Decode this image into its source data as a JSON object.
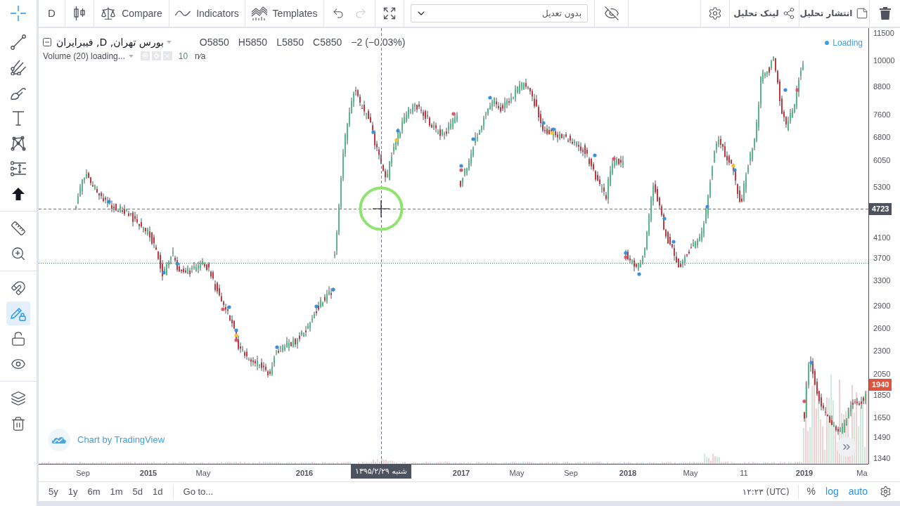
{
  "left_toolbar": {
    "groups": [
      {
        "items": [
          {
            "kind": "crosshair",
            "selected": true
          },
          {
            "kind": "trend_line",
            "selected": false
          },
          {
            "kind": "pitchfork",
            "selected": false
          },
          {
            "kind": "brush",
            "selected": false
          },
          {
            "kind": "text",
            "selected": false
          },
          {
            "kind": "pattern",
            "selected": false
          },
          {
            "kind": "projection",
            "selected": false
          },
          {
            "kind": "arrow",
            "selected": false
          }
        ]
      },
      {
        "items": [
          {
            "kind": "ruler",
            "selected": false
          },
          {
            "kind": "zoom",
            "selected": false
          }
        ]
      },
      {
        "items": [
          {
            "kind": "magnet",
            "on": false
          },
          {
            "kind": "stay_in_drawing",
            "on": true
          },
          {
            "kind": "lock",
            "on": false
          },
          {
            "kind": "visibility",
            "on": false
          }
        ]
      },
      {
        "items": [
          {
            "kind": "layers"
          },
          {
            "kind": "remove"
          }
        ]
      }
    ]
  },
  "toolbar": {
    "interval": "D",
    "compare": "Compare",
    "indicators": "Indicators",
    "templates": "Templates",
    "undo": {
      "disabled": false
    },
    "redo": {
      "disabled": true
    },
    "adjustment": {
      "value": "بدون تعدیل"
    },
    "link_analysis": "لینک تحلیل",
    "publish_analysis": "انتشار تحلیل"
  },
  "legend": {
    "symbol": "بورس تهران, D, فیبرایران",
    "ohlc": [
      "O5850",
      "H5850",
      "L5850",
      "C5850"
    ],
    "change": "−2 (−0.03%)",
    "study": {
      "title": "Volume (20) loading...",
      "value": "10",
      "status": "n∕a"
    }
  },
  "status": {
    "label": "Loading"
  },
  "attribution": "Chart by TradingView",
  "price_axis": {
    "labels": [
      {
        "text": "11500",
        "kind": "tick"
      },
      {
        "text": "10000",
        "kind": "tick"
      },
      {
        "text": "8800",
        "kind": "tick"
      },
      {
        "text": "7600",
        "kind": "tick"
      },
      {
        "text": "6800",
        "kind": "tick"
      },
      {
        "text": "6050",
        "kind": "tick"
      },
      {
        "text": "5300",
        "kind": "tick"
      },
      {
        "text": "4723",
        "kind": "crosshair"
      },
      {
        "text": "4100",
        "kind": "tick"
      },
      {
        "text": "3700",
        "kind": "tick"
      },
      {
        "text": "3300",
        "kind": "tick"
      },
      {
        "text": "2900",
        "kind": "tick"
      },
      {
        "text": "2600",
        "kind": "tick"
      },
      {
        "text": "2300",
        "kind": "tick"
      },
      {
        "text": "2050",
        "kind": "tick"
      },
      {
        "text": "1940",
        "kind": "last_price"
      },
      {
        "text": "1850",
        "kind": "tick"
      },
      {
        "text": "1650",
        "kind": "tick"
      },
      {
        "text": "1490",
        "kind": "tick"
      },
      {
        "text": "1340",
        "kind": "tick"
      }
    ]
  },
  "time_axis": {
    "labels": [
      {
        "text": "Sep",
        "kind": "month"
      },
      {
        "text": "2015",
        "kind": "year"
      },
      {
        "text": "May",
        "kind": "month"
      },
      {
        "text": "2016",
        "kind": "year"
      },
      {
        "text": "شنبه ۱۳۹۵/۲/۲۹",
        "kind": "crosshair"
      },
      {
        "text": "2017",
        "kind": "year"
      },
      {
        "text": "May",
        "kind": "month"
      },
      {
        "text": "Sep",
        "kind": "month"
      },
      {
        "text": "2018",
        "kind": "year"
      },
      {
        "text": "May",
        "kind": "month"
      },
      {
        "text": "11",
        "kind": "month"
      },
      {
        "text": "2019",
        "kind": "year"
      },
      {
        "text": "Ma",
        "kind": "month"
      }
    ]
  },
  "bottom_bar": {
    "ranges": [
      "5y",
      "1y",
      "6m",
      "1m",
      "5d",
      "1d"
    ],
    "goto": "Go to...",
    "time": "۱۲:۲۳ (UTC)",
    "scale_modes": [
      {
        "label": "%",
        "on": false
      },
      {
        "label": "log",
        "on": true
      },
      {
        "label": "auto",
        "on": true
      }
    ]
  }
}
